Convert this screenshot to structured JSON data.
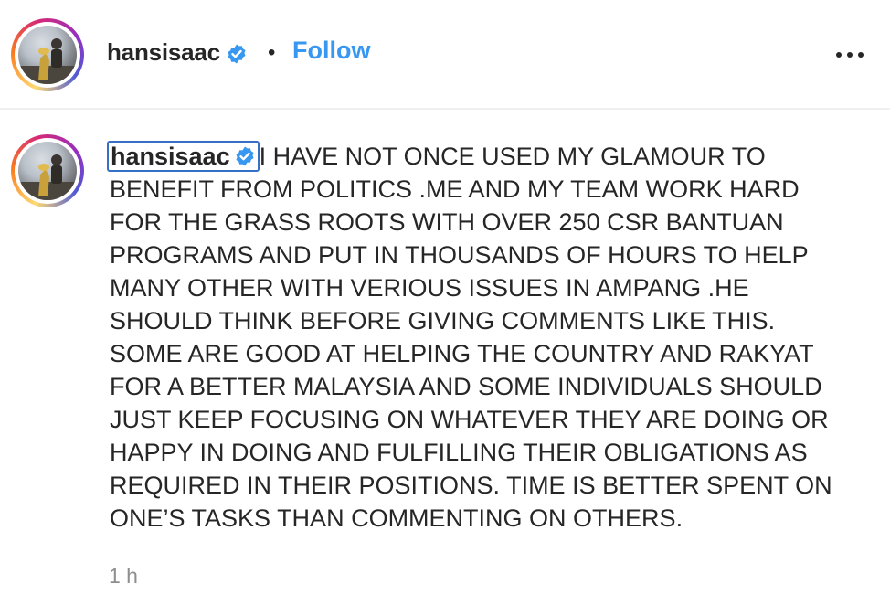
{
  "post_header": {
    "username": "hansisaac",
    "separator": "•",
    "follow_label": "Follow",
    "more_icon": "more-horizontal-icon"
  },
  "comment": {
    "username": "hansisaac",
    "text": "I HAVE NOT ONCE USED MY GLAMOUR TO BENEFIT FROM POLITICS .ME AND MY TEAM WORK HARD FOR THE GRASS ROOTS WITH OVER 250 CSR BANTUAN PROGRAMS AND PUT IN THOUSANDS OF HOURS TO HELP MANY OTHER WITH VERIOUS ISSUES IN AMPANG .HE SHOULD THINK BEFORE GIVING COMMENTS LIKE THIS. SOME ARE GOOD AT HELPING THE COUNTRY AND RAKYAT FOR A BETTER MALAYSIA AND SOME INDIVIDUALS SHOULD JUST KEEP FOCUSING ON WHATEVER THEY ARE DOING OR HAPPY IN DOING AND FULFILLING THEIR OBLIGATIONS AS REQUIRED IN THEIR POSITIONS. TIME IS BETTER SPENT ON ONE’S TASKS THAN COMMENTING ON OTHERS.",
    "timestamp": "1 h"
  },
  "colors": {
    "follow": "#3897f0",
    "verified": "#3897f0",
    "username_highlight": "#3570c6",
    "timestamp": "#8e8e8e"
  }
}
